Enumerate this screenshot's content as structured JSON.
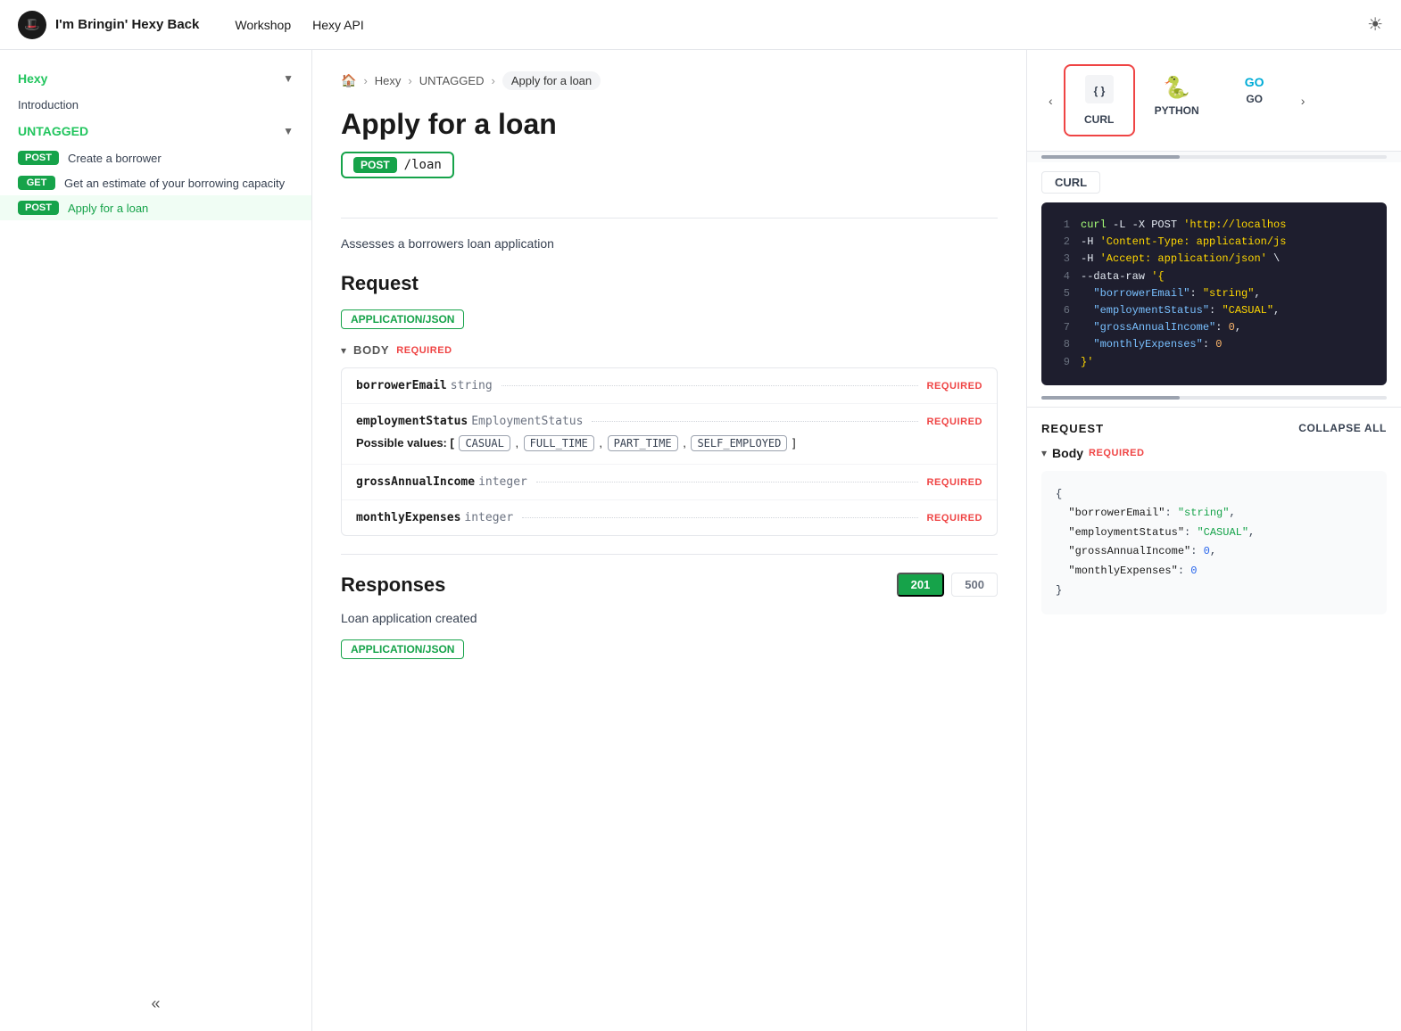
{
  "nav": {
    "logo_text": "I'm Bringin' Hexy Back",
    "links": [
      "Workshop",
      "Hexy API"
    ],
    "sun_icon": "☀"
  },
  "sidebar": {
    "section_title": "Hexy",
    "intro_label": "Introduction",
    "untagged_label": "UNTAGGED",
    "items": [
      {
        "method": "POST",
        "label": "Create a borrower",
        "active": false
      },
      {
        "method": "GET",
        "label": "Get an estimate of your borrowing capacity",
        "active": false
      },
      {
        "method": "POST",
        "label": "Apply for a loan",
        "active": true
      }
    ],
    "collapse_icon": "«"
  },
  "breadcrumb": {
    "home_icon": "🏠",
    "items": [
      "Hexy",
      "UNTAGGED",
      "Apply for a loan"
    ]
  },
  "page": {
    "title": "Apply for a loan",
    "method": "POST",
    "path": "/loan",
    "description": "Assesses a borrowers loan application",
    "request_section": "Request",
    "content_type": "APPLICATION/JSON",
    "body_label": "BODY",
    "required_label": "REQUIRED",
    "fields": [
      {
        "name": "borrowerEmail",
        "type": "string",
        "required": true,
        "possible_values": []
      },
      {
        "name": "employmentStatus",
        "type": "EmploymentStatus",
        "required": true,
        "has_possible": true,
        "possible_values": [
          "CASUAL",
          "FULL_TIME",
          "PART_TIME",
          "SELF_EMPLOYED"
        ]
      },
      {
        "name": "grossAnnualIncome",
        "type": "integer",
        "required": true,
        "possible_values": []
      },
      {
        "name": "monthlyExpenses",
        "type": "integer",
        "required": true,
        "possible_values": []
      }
    ],
    "responses_title": "Responses",
    "response_codes": [
      {
        "code": "201",
        "active": true
      },
      {
        "code": "500",
        "active": false
      }
    ],
    "response_desc": "Loan application created",
    "response_content_type": "APPLICATION/JSON"
  },
  "code_panel": {
    "lang_tabs": [
      {
        "label": "CURL",
        "icon": "💻",
        "active": true
      },
      {
        "label": "PYTHON",
        "icon": "🐍",
        "active": false
      },
      {
        "label": "GO",
        "icon": "🔷",
        "active": false
      }
    ],
    "curl_label": "CURL",
    "code_lines": [
      {
        "num": "1",
        "content": "curl -L -X POST 'http://localhos"
      },
      {
        "num": "2",
        "content": "-H 'Content-Type: application/js"
      },
      {
        "num": "3",
        "content": "-H 'Accept: application/json' \\"
      },
      {
        "num": "4",
        "content": "--data-raw '{"
      },
      {
        "num": "5",
        "content": "  \"borrowerEmail\": \"string\","
      },
      {
        "num": "6",
        "content": "  \"employmentStatus\": \"CASUAL\","
      },
      {
        "num": "7",
        "content": "  \"grossAnnualIncome\": 0,"
      },
      {
        "num": "8",
        "content": "  \"monthlyExpenses\": 0"
      },
      {
        "num": "9",
        "content": "}'"
      }
    ],
    "request_label": "REQUEST",
    "collapse_all_label": "COLLAPSE ALL",
    "body_label": "Body",
    "body_required": "REQUIRED",
    "json_preview": {
      "borrowerEmail": "\"string\"",
      "employmentStatus": "\"CASUAL\"",
      "grossAnnualIncome": "0",
      "monthlyExpenses": "0"
    }
  }
}
